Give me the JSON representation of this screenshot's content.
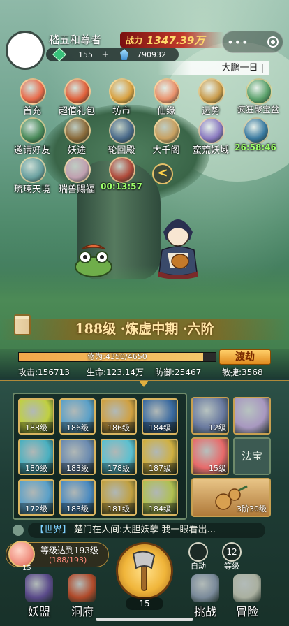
{
  "player": {
    "name": "嵇五和尊者",
    "power_label": "战力",
    "power_value": "1347.39万",
    "jade": "155",
    "plus": "+",
    "crystal": "790932"
  },
  "region": "大鹏一日 |",
  "top_icons": [
    {
      "label": "首充",
      "color": "#e86a4a"
    },
    {
      "label": "超值礼包",
      "color": "#e0603a"
    },
    {
      "label": "坊市",
      "color": "#d8a040"
    },
    {
      "label": "仙缘",
      "color": "#e8906a"
    },
    {
      "label": "运势",
      "color": "#c89a4a"
    },
    {
      "label": "疯狂聚宝盆",
      "color": "#5aa06a"
    },
    {
      "label": "邀请好友",
      "color": "#4a8a5a"
    },
    {
      "label": "妖途",
      "color": "#8a6a3a"
    },
    {
      "label": "轮回殿",
      "color": "#4a6a8a"
    },
    {
      "label": "大千阁",
      "color": "#c8a060"
    },
    {
      "label": "蛮荒妖域",
      "color": "#8a7ac0"
    },
    {
      "label": "26:58:46",
      "color": "#3a7aa0",
      "timer": true
    },
    {
      "label": "琉璃天境",
      "color": "#6aa0a0"
    },
    {
      "label": "瑞兽赐福",
      "color": "#c0a0b0"
    },
    {
      "label": "00:13:57",
      "color": "#b04a3a",
      "timer": true
    }
  ],
  "arrow": "<",
  "level_banner": "188级 ·炼虚中期 ·六阶",
  "cultivation": {
    "label": "修为",
    "current": "4350",
    "max": "4650",
    "text": "修为:4350/4650",
    "fraction": 0.935
  },
  "dujie_label": "渡劫",
  "stats": {
    "attack": "攻击:156713",
    "hp": "生命:123.14万",
    "defense": "防御:25467",
    "agility": "敏捷:3568"
  },
  "gear": [
    {
      "level": "188级",
      "color": "#c0d040"
    },
    {
      "level": "186级",
      "color": "#5aa0c8"
    },
    {
      "level": "186级",
      "color": "#d0a040"
    },
    {
      "level": "184级",
      "color": "#3a6aa0"
    },
    {
      "level": "180级",
      "color": "#4ab0c0"
    },
    {
      "level": "183级",
      "color": "#6a8ab0"
    },
    {
      "level": "178级",
      "color": "#5ac0d0"
    },
    {
      "level": "187级",
      "color": "#d0b040"
    },
    {
      "level": "172级",
      "color": "#5aa0c8"
    },
    {
      "level": "183级",
      "color": "#4a8ac0"
    },
    {
      "level": "181级",
      "color": "#c0a040"
    },
    {
      "level": "184级",
      "color": "#b0c050"
    }
  ],
  "pets": [
    {
      "level": "12级",
      "color": "#6a7aa0"
    },
    {
      "level": "",
      "color": "#a898c0"
    },
    {
      "level": "15级",
      "color": "#e86a6a"
    }
  ],
  "fabao_label": "法宝",
  "mount_level": "3阶30级",
  "chat": {
    "channel": "【世界】",
    "message": "楚门在人间:大胆妖孽 我一眼看出..."
  },
  "goal": {
    "text": "等级达到193级",
    "progress": "(188/193)",
    "num": "15"
  },
  "axe_count": "15",
  "auto_label": "自动",
  "level_btn": {
    "value": "12",
    "label": "等级"
  },
  "nav": [
    {
      "label": "妖盟",
      "color": "#5a4a8a"
    },
    {
      "label": "洞府",
      "color": "#b04a2a"
    },
    {
      "label": "挑战",
      "color": "#7a8a9a"
    },
    {
      "label": "冒险",
      "color": "#aab0a0"
    }
  ],
  "colors": {
    "accent_gold": "#e0b040",
    "power_red": "#c0392b",
    "timer_green": "#9cff6a"
  }
}
